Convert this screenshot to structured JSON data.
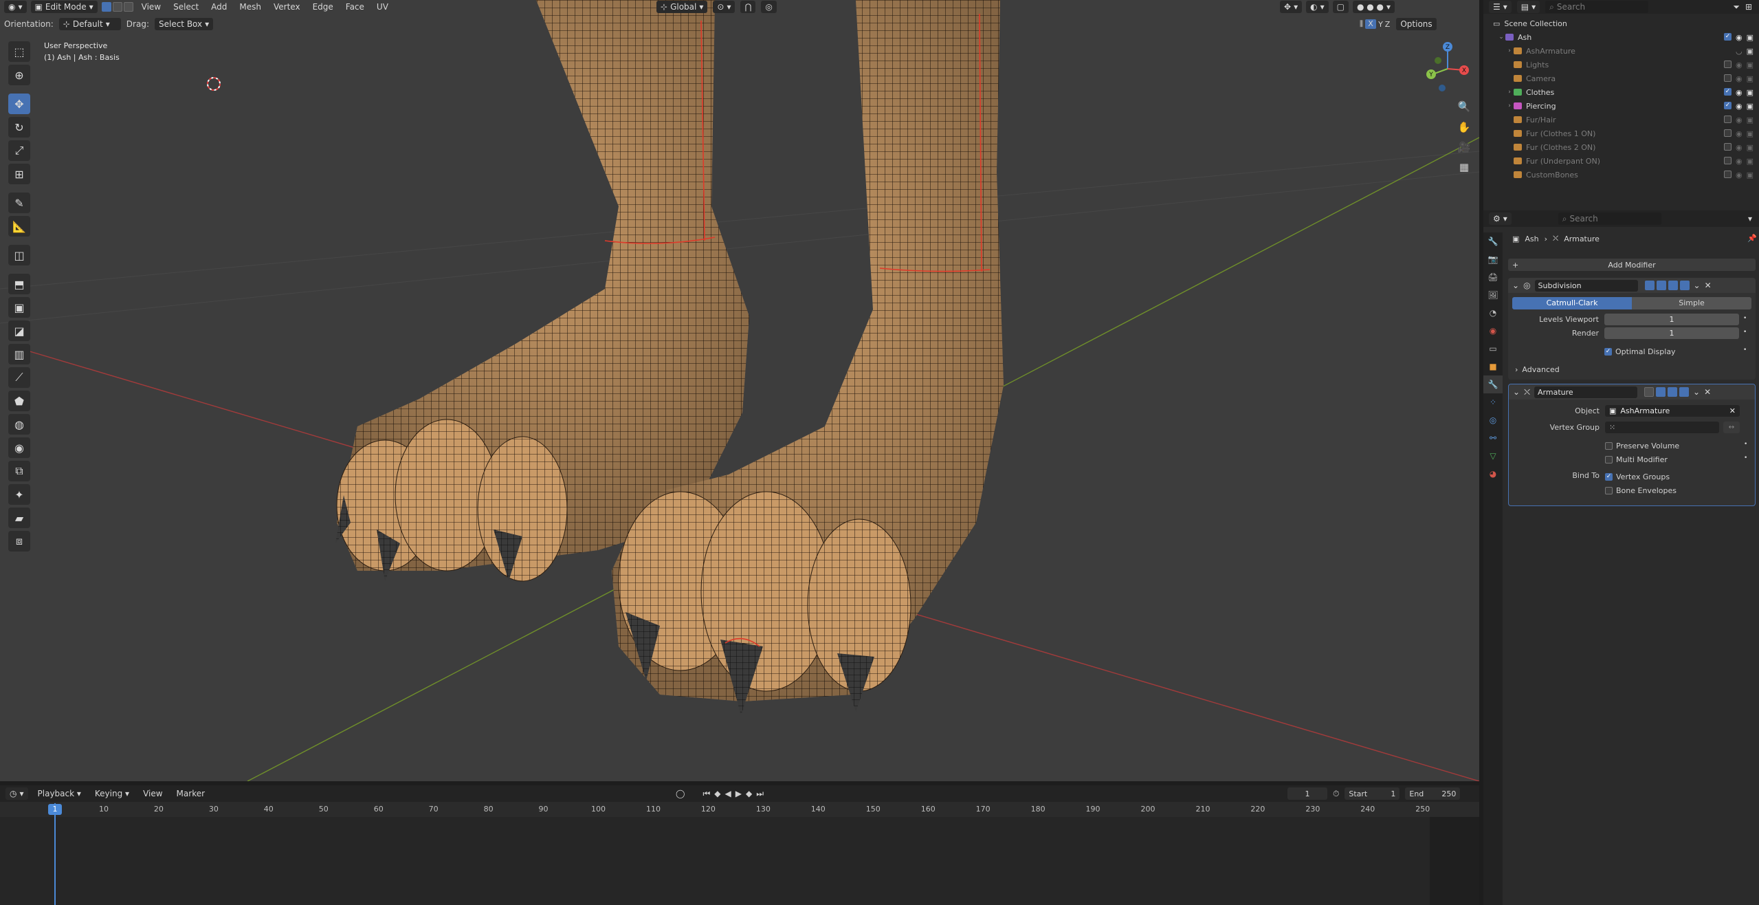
{
  "header": {
    "editor_icon": "3d-viewport-icon",
    "mode": "Edit Mode",
    "menus": [
      "View",
      "Select",
      "Add",
      "Mesh",
      "Vertex",
      "Edge",
      "Face",
      "UV"
    ],
    "transform_orientation": "Global",
    "search_placeholder": "Search",
    "orientation_label": "Orientation:",
    "orientation_value": "Default",
    "drag_label": "Drag:",
    "drag_value": "Select Box",
    "axis_x": "X",
    "axis_y": "Y",
    "axis_z": "Z",
    "options": "Options"
  },
  "viewport": {
    "view_name": "User Perspective",
    "object_info": "(1) Ash | Ash : Basis"
  },
  "timeline": {
    "menus": [
      "Playback",
      "Keying",
      "View",
      "Marker"
    ],
    "current_frame": "1",
    "start_label": "Start",
    "start_value": "1",
    "end_label": "End",
    "end_value": "250",
    "playhead_frame": "1",
    "ticks": [
      "10",
      "20",
      "30",
      "40",
      "50",
      "60",
      "70",
      "80",
      "90",
      "100",
      "110",
      "120",
      "130",
      "140",
      "150",
      "160",
      "170",
      "180",
      "190",
      "200",
      "210",
      "220",
      "230",
      "240",
      "250"
    ]
  },
  "outliner": {
    "search_placeholder": "Search",
    "root": "Scene Collection",
    "items": [
      {
        "label": "Ash",
        "color": "#7a5fc0",
        "dim": false
      },
      {
        "label": "AshArmature",
        "color": "#c0853a",
        "dim": true
      },
      {
        "label": "Lights",
        "color": "#c0853a",
        "dim": true
      },
      {
        "label": "Camera",
        "color": "#c0853a",
        "dim": true
      },
      {
        "label": "Clothes",
        "color": "#4fae5a",
        "dim": false
      },
      {
        "label": "Piercing",
        "color": "#c556c0",
        "dim": false
      },
      {
        "label": "Fur/Hair",
        "color": "#c0853a",
        "dim": true
      },
      {
        "label": "Fur (Clothes 1 ON)",
        "color": "#c0853a",
        "dim": true
      },
      {
        "label": "Fur (Clothes 2 ON)",
        "color": "#c0853a",
        "dim": true
      },
      {
        "label": "Fur (Underpant ON)",
        "color": "#c0853a",
        "dim": true
      },
      {
        "label": "CustomBones",
        "color": "#c0853a",
        "dim": true
      }
    ]
  },
  "properties": {
    "search_placeholder": "Search",
    "breadcrumb_object": "Ash",
    "breadcrumb_modifier": "Armature",
    "add_modifier": "Add Modifier",
    "subdivision": {
      "name": "Subdivision",
      "tab_catmull": "Catmull-Clark",
      "tab_simple": "Simple",
      "levels_viewport_label": "Levels Viewport",
      "levels_viewport_value": "1",
      "render_label": "Render",
      "render_value": "1",
      "optimal_display": "Optimal Display",
      "advanced": "Advanced"
    },
    "armature": {
      "name": "Armature",
      "object_label": "Object",
      "object_value": "AshArmature",
      "vertex_group_label": "Vertex Group",
      "preserve_volume": "Preserve Volume",
      "multi_modifier": "Multi Modifier",
      "bind_to_label": "Bind To",
      "vertex_groups": "Vertex Groups",
      "bone_envelopes": "Bone Envelopes"
    }
  },
  "colors": {
    "accent": "#4772b3",
    "viewport_bg": "#3d3d3d",
    "mesh_skin": "#c99a67",
    "seam": "#e03a2a"
  }
}
